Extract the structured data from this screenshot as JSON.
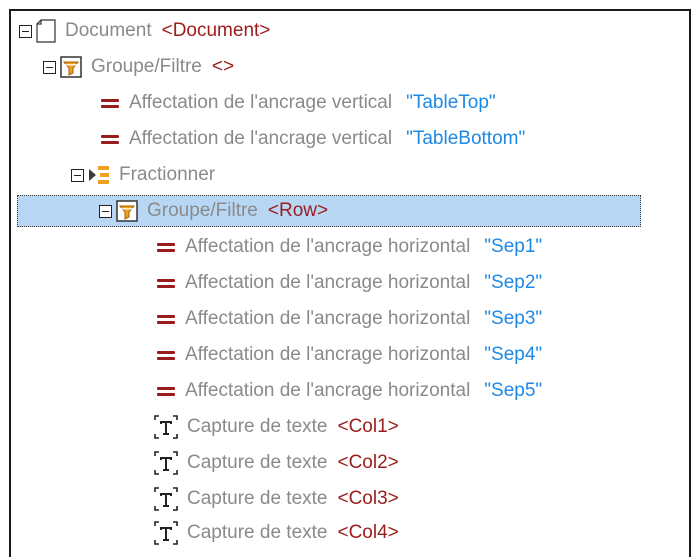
{
  "tree": {
    "document": {
      "label": "Document",
      "tag": "<Document>"
    },
    "group1": {
      "label": "Groupe/Filtre",
      "tag": "<>"
    },
    "anchor_v1": {
      "label": "Affectation de l'ancrage vertical",
      "value": "\"TableTop\""
    },
    "anchor_v2": {
      "label": "Affectation de l'ancrage vertical",
      "value": "\"TableBottom\""
    },
    "split": {
      "label": "Fractionner"
    },
    "group2": {
      "label": "Groupe/Filtre",
      "tag": "<Row>"
    },
    "anchors_h": [
      {
        "label": "Affectation de l'ancrage horizontal",
        "value": "\"Sep1\""
      },
      {
        "label": "Affectation de l'ancrage horizontal",
        "value": "\"Sep2\""
      },
      {
        "label": "Affectation de l'ancrage horizontal",
        "value": "\"Sep3\""
      },
      {
        "label": "Affectation de l'ancrage horizontal",
        "value": "\"Sep4\""
      },
      {
        "label": "Affectation de l'ancrage horizontal",
        "value": "\"Sep5\""
      }
    ],
    "captures": [
      {
        "label": "Capture de texte",
        "tag": "<Col1>"
      },
      {
        "label": "Capture de texte",
        "tag": "<Col2>"
      },
      {
        "label": "Capture de texte",
        "tag": "<Col3>"
      },
      {
        "label": "Capture de texte",
        "tag": "<Col4>"
      }
    ]
  },
  "icons": {
    "document": "document-icon",
    "filter": "filter-icon",
    "assignment": "equals-icon",
    "split": "split-icon",
    "text_capture": "text-capture-icon",
    "collapse": "collapse-toggle-icon"
  },
  "colors": {
    "label": "#8a8a8a",
    "tag": "#9b1c1c",
    "string": "#1e88e5",
    "selection": "#b8d7f5",
    "filter_orange": "#f0a020"
  }
}
